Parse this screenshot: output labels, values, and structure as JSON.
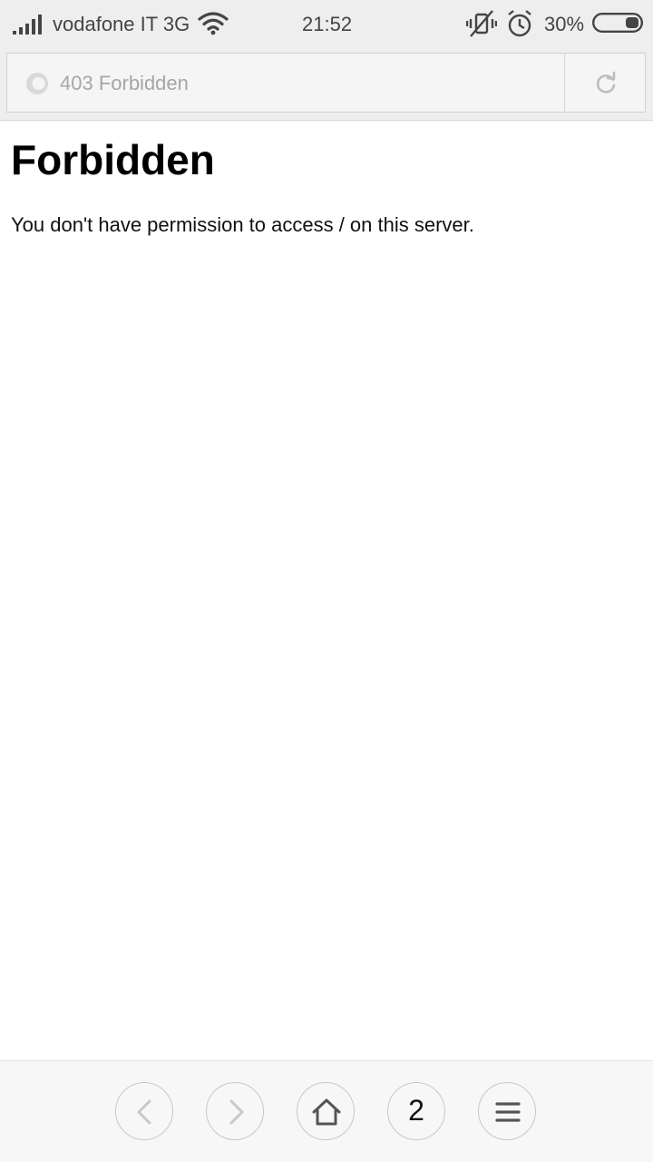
{
  "status_bar": {
    "carrier": "vodafone IT 3G",
    "time": "21:52",
    "battery_percent": "30%",
    "battery_level": 0.3,
    "icons": [
      "signal-icon",
      "wifi-icon",
      "vibrate-mute-icon",
      "alarm-icon",
      "battery-icon"
    ]
  },
  "address_bar": {
    "page_title": "403 Forbidden",
    "icons": [
      "site-icon",
      "reload-icon"
    ]
  },
  "page": {
    "heading": "Forbidden",
    "message": "You don't have permission to access / on this server."
  },
  "bottom_nav": {
    "tab_count": "2",
    "icons": [
      "back-icon",
      "forward-icon",
      "home-icon",
      "menu-icon"
    ]
  },
  "colors": {
    "status_bar_bg": "#eeeeee",
    "address_text": "#a6a6a6",
    "nav_disabled": "#c8c8c8",
    "nav_active": "#555555"
  }
}
